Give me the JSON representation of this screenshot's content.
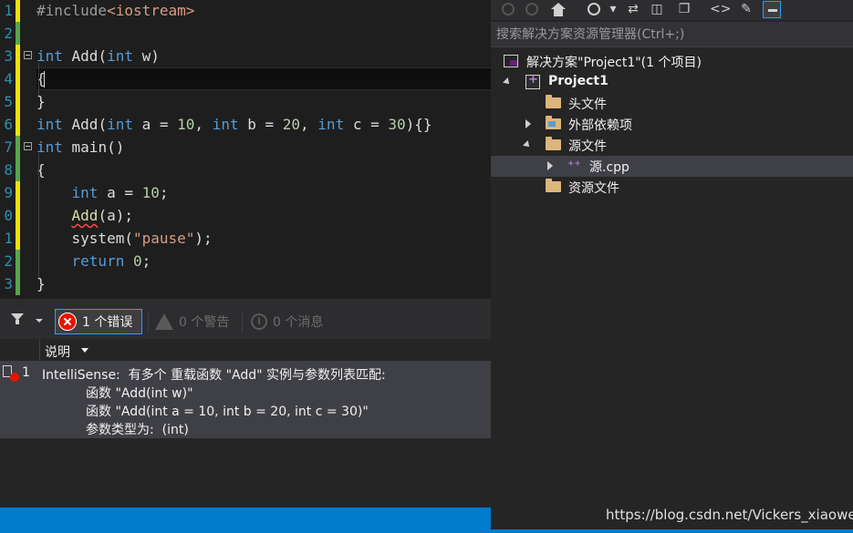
{
  "editor": {
    "lines": [
      {
        "num": "1",
        "bar": "yellow",
        "fold": false,
        "tokens": [
          {
            "t": "#include",
            "c": "pp"
          },
          {
            "t": "<iostream>",
            "c": "str"
          }
        ]
      },
      {
        "num": "2",
        "bar": "green",
        "fold": false,
        "tokens": []
      },
      {
        "num": "3",
        "bar": "yellow",
        "fold": true,
        "tokens": [
          {
            "t": "int",
            "c": "kw"
          },
          {
            "t": " Add(",
            "c": "tx"
          },
          {
            "t": "int",
            "c": "kw"
          },
          {
            "t": " w)",
            "c": "tx"
          }
        ]
      },
      {
        "num": "4",
        "bar": "yellow",
        "fold": false,
        "current": true,
        "tokens": [
          {
            "t": "{",
            "c": "tx"
          }
        ]
      },
      {
        "num": "5",
        "bar": "yellow",
        "fold": false,
        "tokens": [
          {
            "t": "}",
            "c": "tx"
          }
        ]
      },
      {
        "num": "6",
        "bar": "yellow",
        "fold": false,
        "tokens": [
          {
            "t": "int",
            "c": "kw"
          },
          {
            "t": " Add(",
            "c": "tx"
          },
          {
            "t": "int",
            "c": "kw"
          },
          {
            "t": " a = ",
            "c": "tx"
          },
          {
            "t": "10",
            "c": "num"
          },
          {
            "t": ", ",
            "c": "tx"
          },
          {
            "t": "int",
            "c": "kw"
          },
          {
            "t": " b = ",
            "c": "tx"
          },
          {
            "t": "20",
            "c": "num"
          },
          {
            "t": ", ",
            "c": "tx"
          },
          {
            "t": "int",
            "c": "kw"
          },
          {
            "t": " c = ",
            "c": "tx"
          },
          {
            "t": "30",
            "c": "num"
          },
          {
            "t": "){}",
            "c": "tx"
          }
        ]
      },
      {
        "num": "7",
        "bar": "green",
        "fold": true,
        "tokens": [
          {
            "t": "int",
            "c": "kw"
          },
          {
            "t": " main()",
            "c": "tx"
          }
        ]
      },
      {
        "num": "8",
        "bar": "green",
        "fold": false,
        "tokens": [
          {
            "t": "{",
            "c": "tx"
          }
        ]
      },
      {
        "num": "9",
        "bar": "yellow",
        "fold": false,
        "tokens": [
          {
            "t": "    ",
            "c": "tx"
          },
          {
            "t": "int",
            "c": "kw"
          },
          {
            "t": " a = ",
            "c": "tx"
          },
          {
            "t": "10",
            "c": "num"
          },
          {
            "t": ";",
            "c": "tx"
          }
        ]
      },
      {
        "num": "0",
        "bar": "yellow",
        "fold": false,
        "tokens": [
          {
            "t": "    ",
            "c": "tx"
          },
          {
            "t": "Add",
            "c": "fn squig"
          },
          {
            "t": "(a);",
            "c": "tx"
          }
        ]
      },
      {
        "num": "1",
        "bar": "yellow",
        "fold": false,
        "tokens": [
          {
            "t": "    ",
            "c": "tx"
          },
          {
            "t": "system(",
            "c": "tx"
          },
          {
            "t": "\"pause\"",
            "c": "str"
          },
          {
            "t": ");",
            "c": "tx"
          }
        ]
      },
      {
        "num": "2",
        "bar": "green",
        "fold": false,
        "tokens": [
          {
            "t": "    ",
            "c": "tx"
          },
          {
            "t": "return",
            "c": "kw"
          },
          {
            "t": " ",
            "c": "tx"
          },
          {
            "t": "0",
            "c": "num"
          },
          {
            "t": ";",
            "c": "tx"
          }
        ]
      },
      {
        "num": "3",
        "bar": "green",
        "fold": false,
        "tokens": [
          {
            "t": "}",
            "c": "tx"
          }
        ]
      }
    ]
  },
  "error_list": {
    "errors_label": "1 个错误",
    "warnings_label": "0 个警告",
    "messages_label": "0 个消息",
    "column_description": "说明",
    "row": {
      "number": "1",
      "lines": [
        "IntelliSense:  有多个 重载函数 \"Add\" 实例与参数列表匹配:",
        "函数 \"Add(int w)\"",
        "函数 \"Add(int a = 10, int b = 20, int c = 30)\"",
        "参数类型为:  (int)"
      ]
    }
  },
  "solution_explorer": {
    "search_placeholder": "搜索解决方案资源管理器(Ctrl+;)",
    "tree": [
      {
        "label": "解决方案\"Project1\"(1 个项目)",
        "icon": "solution-icon",
        "expander": "none",
        "indent": 0
      },
      {
        "label": "Project1",
        "icon": "project-icon",
        "expander": "down",
        "indent": 1,
        "bold": true
      },
      {
        "label": "头文件",
        "icon": "folder-icon",
        "expander": "none",
        "indent": 2
      },
      {
        "label": "外部依赖项",
        "icon": "folder-icon",
        "expander": "right",
        "indent": 2
      },
      {
        "label": "源文件",
        "icon": "folder-icon",
        "expander": "down",
        "indent": 2
      },
      {
        "label": "源.cpp",
        "icon": "cpp-icon",
        "expander": "right",
        "indent": 3,
        "selected": true
      },
      {
        "label": "资源文件",
        "icon": "folder-icon",
        "expander": "none",
        "indent": 2
      }
    ]
  },
  "watermark": "https://blog.csdn.net/Vickers_xiaowei",
  "colors": {
    "keyword": "#569cd6",
    "number": "#b5cea8",
    "string": "#d69d85",
    "error": "#e51400",
    "accent": "#007acc"
  }
}
